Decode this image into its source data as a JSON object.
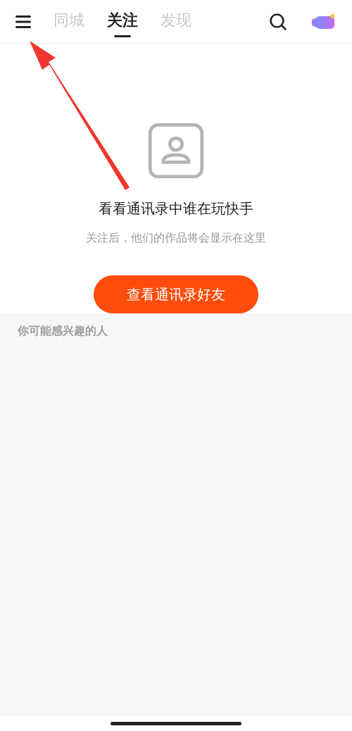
{
  "top_bar": {
    "tabs": [
      {
        "label": "同城",
        "selected": false
      },
      {
        "label": "关注",
        "selected": true
      },
      {
        "label": "发现",
        "selected": false
      }
    ]
  },
  "empty_state": {
    "title": "看看通讯录中谁在玩快手",
    "subtitle": "关注后，他们的作品将会显示在这里",
    "button": "查看通讯录好友"
  },
  "suggestions": {
    "heading": "你可能感兴趣的人"
  }
}
